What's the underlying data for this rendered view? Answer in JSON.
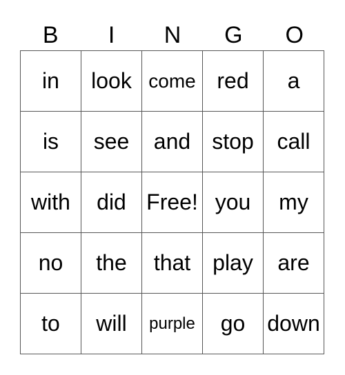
{
  "header": [
    "B",
    "I",
    "N",
    "G",
    "O"
  ],
  "rows": [
    [
      "in",
      "look",
      "come",
      "red",
      "a"
    ],
    [
      "is",
      "see",
      "and",
      "stop",
      "call"
    ],
    [
      "with",
      "did",
      "Free!",
      "you",
      "my"
    ],
    [
      "no",
      "the",
      "that",
      "play",
      "are"
    ],
    [
      "to",
      "will",
      "purple",
      "go",
      "down"
    ]
  ]
}
